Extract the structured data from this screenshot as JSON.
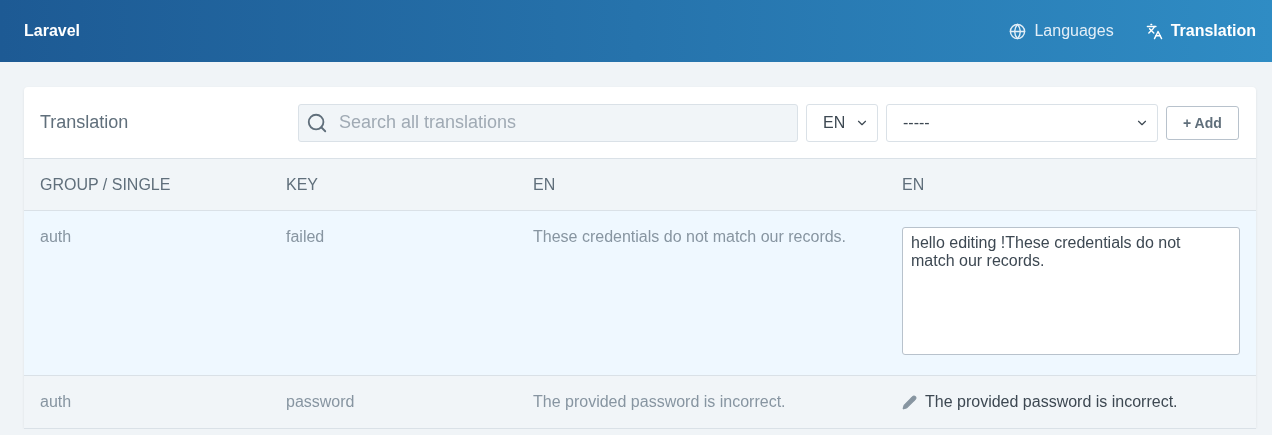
{
  "navbar": {
    "brand": "Laravel",
    "links": [
      {
        "label": "Languages",
        "selected": false
      },
      {
        "label": "Translation",
        "selected": true
      }
    ]
  },
  "card": {
    "title": "Translation",
    "search": {
      "placeholder": "Search all translations"
    },
    "language_select": {
      "value": "EN"
    },
    "group_select": {
      "value": "-----"
    },
    "add_button": "+ Add"
  },
  "table": {
    "columns": [
      "GROUP / SINGLE",
      "KEY",
      "EN",
      "EN"
    ],
    "rows": [
      {
        "group": "auth",
        "key": "failed",
        "source": "These credentials do not match our records.",
        "translation": "hello editing !These credentials do not match our records.",
        "kind": "editing"
      },
      {
        "group": "auth",
        "key": "password",
        "source": "The provided password is incorrect.",
        "translation": "The provided password is incorrect.",
        "kind": "display"
      }
    ]
  }
}
